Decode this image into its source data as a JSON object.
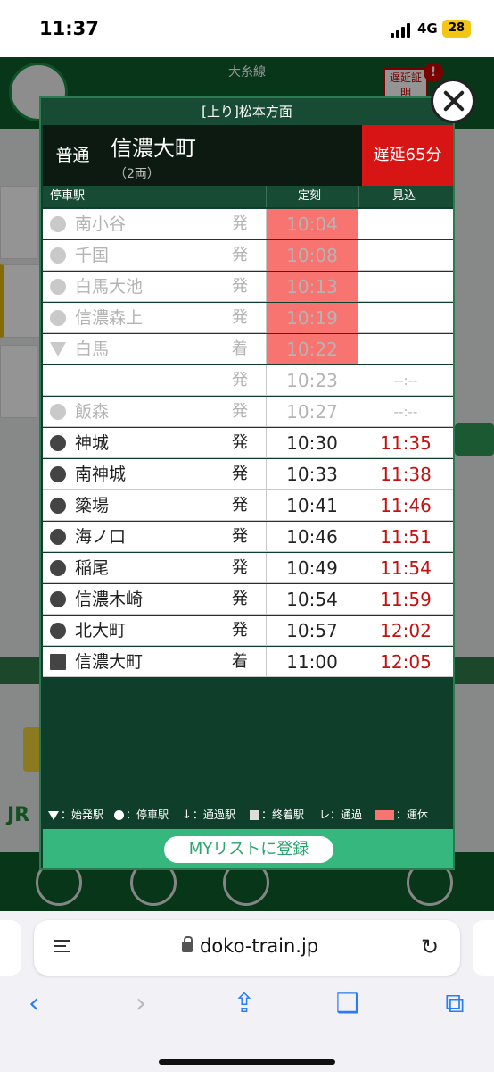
{
  "status_bar": {
    "time": "11:37",
    "network": "4G",
    "battery": "28"
  },
  "app": {
    "line_name": "大糸線",
    "badge_text": "遅延証明",
    "bell": "!"
  },
  "modal": {
    "direction": "[上り]松本方面",
    "train_type": "普通",
    "destination": "信濃大町",
    "cars": "（2両）",
    "delay": "遅延65分",
    "headers": {
      "station": "停車駅",
      "scheduled": "定刻",
      "estimated": "見込"
    },
    "stops": [
      {
        "mark": "circle",
        "station": "南小谷",
        "da": "発",
        "scheduled": "10:04",
        "estimated": "",
        "state": "past",
        "cancelled": true
      },
      {
        "mark": "circle",
        "station": "千国",
        "da": "発",
        "scheduled": "10:08",
        "estimated": "",
        "state": "past",
        "cancelled": true
      },
      {
        "mark": "circle",
        "station": "白馬大池",
        "da": "発",
        "scheduled": "10:13",
        "estimated": "",
        "state": "past",
        "cancelled": true
      },
      {
        "mark": "circle",
        "station": "信濃森上",
        "da": "発",
        "scheduled": "10:19",
        "estimated": "",
        "state": "past",
        "cancelled": true
      },
      {
        "mark": "triangle",
        "station": "白馬",
        "da": "着",
        "scheduled": "10:22",
        "estimated": "",
        "state": "past",
        "cancelled": true
      },
      {
        "mark": "none",
        "station": "",
        "da": "発",
        "scheduled": "10:23",
        "estimated": "--:--",
        "state": "past",
        "cancelled": false
      },
      {
        "mark": "circle",
        "station": "飯森",
        "da": "発",
        "scheduled": "10:27",
        "estimated": "--:--",
        "state": "past",
        "cancelled": false
      },
      {
        "mark": "circle",
        "station": "神城",
        "da": "発",
        "scheduled": "10:30",
        "estimated": "11:35",
        "state": "future",
        "cancelled": false
      },
      {
        "mark": "circle",
        "station": "南神城",
        "da": "発",
        "scheduled": "10:33",
        "estimated": "11:38",
        "state": "future",
        "cancelled": false
      },
      {
        "mark": "circle",
        "station": "簗場",
        "da": "発",
        "scheduled": "10:41",
        "estimated": "11:46",
        "state": "future",
        "cancelled": false
      },
      {
        "mark": "circle",
        "station": "海ノ口",
        "da": "発",
        "scheduled": "10:46",
        "estimated": "11:51",
        "state": "future",
        "cancelled": false
      },
      {
        "mark": "circle",
        "station": "稲尾",
        "da": "発",
        "scheduled": "10:49",
        "estimated": "11:54",
        "state": "future",
        "cancelled": false
      },
      {
        "mark": "circle",
        "station": "信濃木崎",
        "da": "発",
        "scheduled": "10:54",
        "estimated": "11:59",
        "state": "future",
        "cancelled": false
      },
      {
        "mark": "circle",
        "station": "北大町",
        "da": "発",
        "scheduled": "10:57",
        "estimated": "12:02",
        "state": "future",
        "cancelled": false
      },
      {
        "mark": "square",
        "station": "信濃大町",
        "da": "着",
        "scheduled": "11:00",
        "estimated": "12:05",
        "state": "future",
        "cancelled": false
      }
    ],
    "legend": {
      "origin": "：始発駅",
      "stop": "：停車駅",
      "pass": "：通過駅",
      "terminal": "：終着駅",
      "pass_mark": "レ：通過",
      "cancelled": "：運休"
    },
    "mylist_label": "MYリストに登録"
  },
  "browser": {
    "url": "doko-train.jp"
  },
  "colors": {
    "accent_green": "#0f5e2c",
    "delay_red": "#d81515",
    "cancel_pink": "#f77470",
    "estimate_red": "#c41010",
    "ios_blue": "#2a7cf6"
  }
}
